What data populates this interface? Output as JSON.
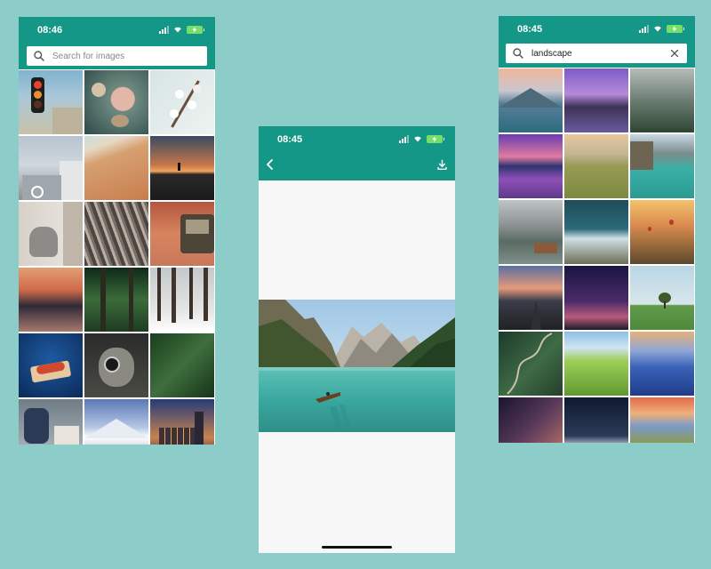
{
  "colors": {
    "background": "#8ccdca",
    "app_bar": "#149787",
    "battery": "#74e06a"
  },
  "left_screen": {
    "status_time": "08:46",
    "search": {
      "placeholder": "Search for images",
      "value": ""
    },
    "photos": [
      "traffic-light",
      "roses",
      "white-blossoms",
      "buildings",
      "sand-beach",
      "sunset-hill",
      "cat",
      "dry-grass",
      "canyon-van",
      "sunset-waves",
      "forest-trail",
      "snowy-forest",
      "hot-dog",
      "monkey-camera",
      "dark-forest",
      "person-sitting",
      "snowy-mountain",
      "city-skyline"
    ]
  },
  "middle_screen": {
    "status_time": "08:45",
    "preview_photo": "lake-boat-mountains"
  },
  "right_screen": {
    "status_time": "08:45",
    "search": {
      "placeholder": "",
      "value": "landscape"
    },
    "photos": [
      "lake-mountains",
      "purple-lake",
      "misty-forest",
      "purple-flowers",
      "meadow-sunset",
      "turquoise-lake",
      "lake-hut",
      "snowy-peaks",
      "balloons",
      "desert-road",
      "night-sky",
      "lone-tree",
      "winding-road",
      "green-hills",
      "blue-mountains",
      "milky-way",
      "dark-mountain",
      "sunset-clouds"
    ]
  }
}
